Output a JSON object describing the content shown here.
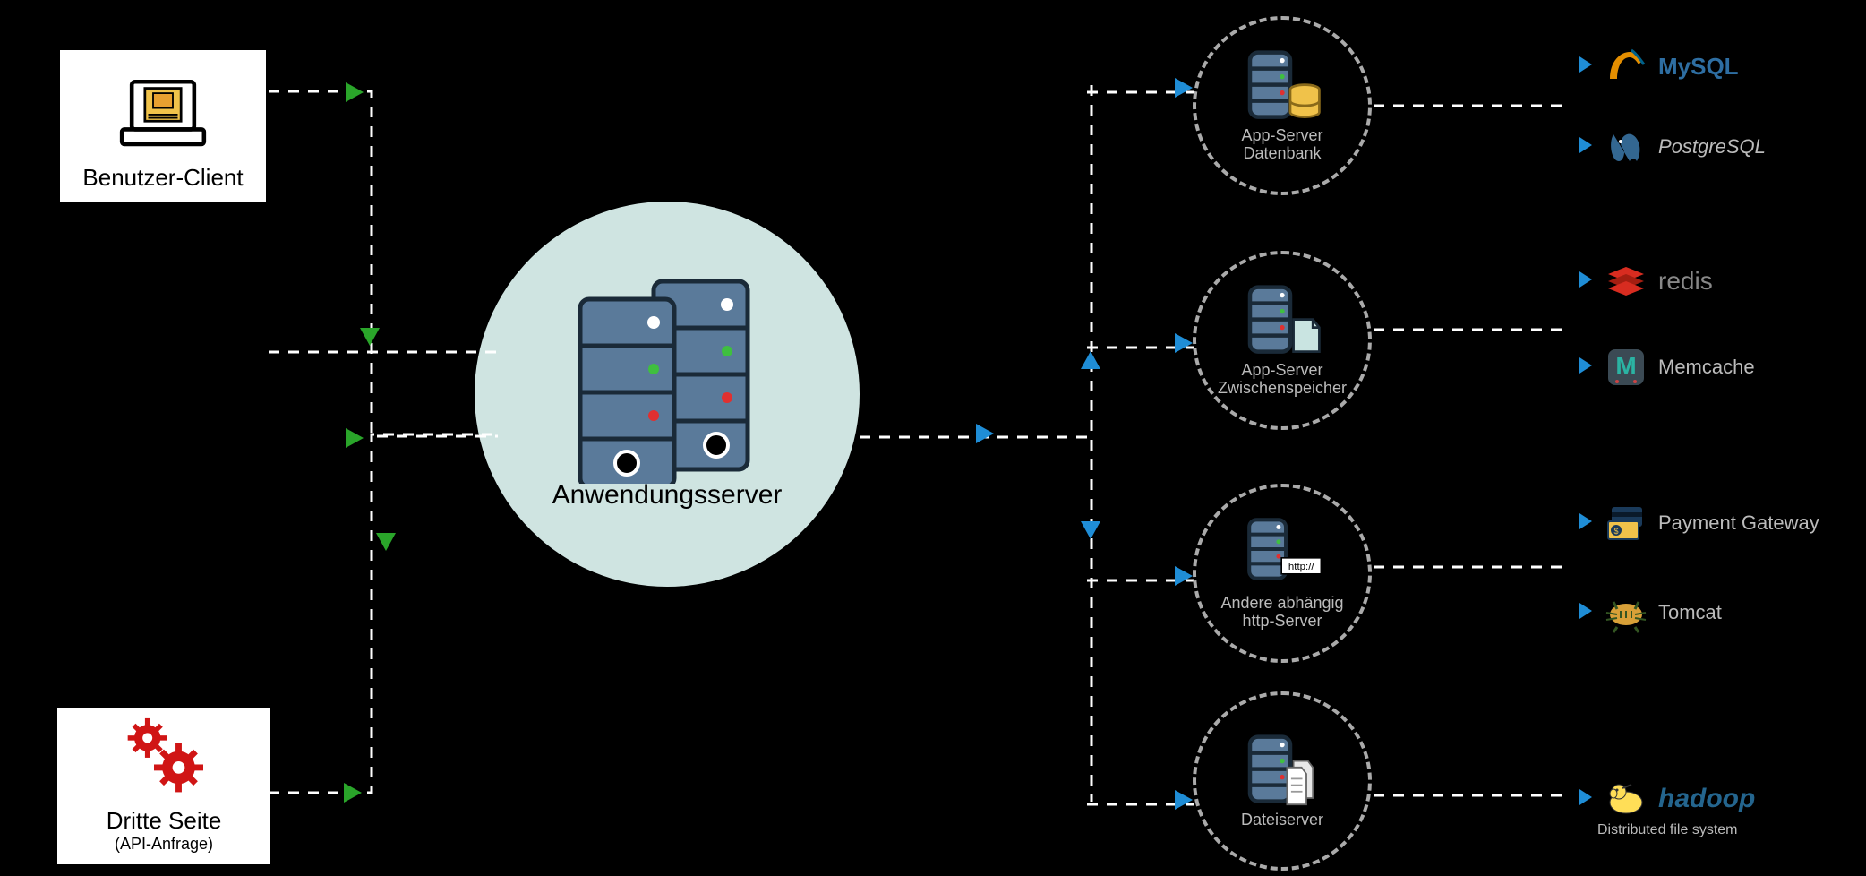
{
  "left": {
    "client": {
      "label": "Benutzer-Client"
    },
    "third_party": {
      "label_main": "Dritte Seite",
      "label_sub": "(API-Anfrage)"
    }
  },
  "center": {
    "label": "Anwendungsserver"
  },
  "backend": {
    "db": {
      "label_line1": "App-Server",
      "label_line2": "Datenbank"
    },
    "cache": {
      "label_line1": "App-Server",
      "label_line2": "Zwischenspeicher"
    },
    "http": {
      "label_line1": "Andere abhängig",
      "label_line2": "http-Server",
      "badge": "http://"
    },
    "file": {
      "label_line1": "Dateiserver"
    }
  },
  "tech": {
    "mysql": {
      "name": "MySQL"
    },
    "postgres": {
      "name": "PostgreSQL"
    },
    "redis": {
      "name": "redis"
    },
    "memcache": {
      "name": "Memcache"
    },
    "payment": {
      "name": "Payment Gateway"
    },
    "tomcat": {
      "name": "Tomcat"
    },
    "hadoop": {
      "name": "hadoop",
      "sub": "Distributed file system"
    }
  }
}
